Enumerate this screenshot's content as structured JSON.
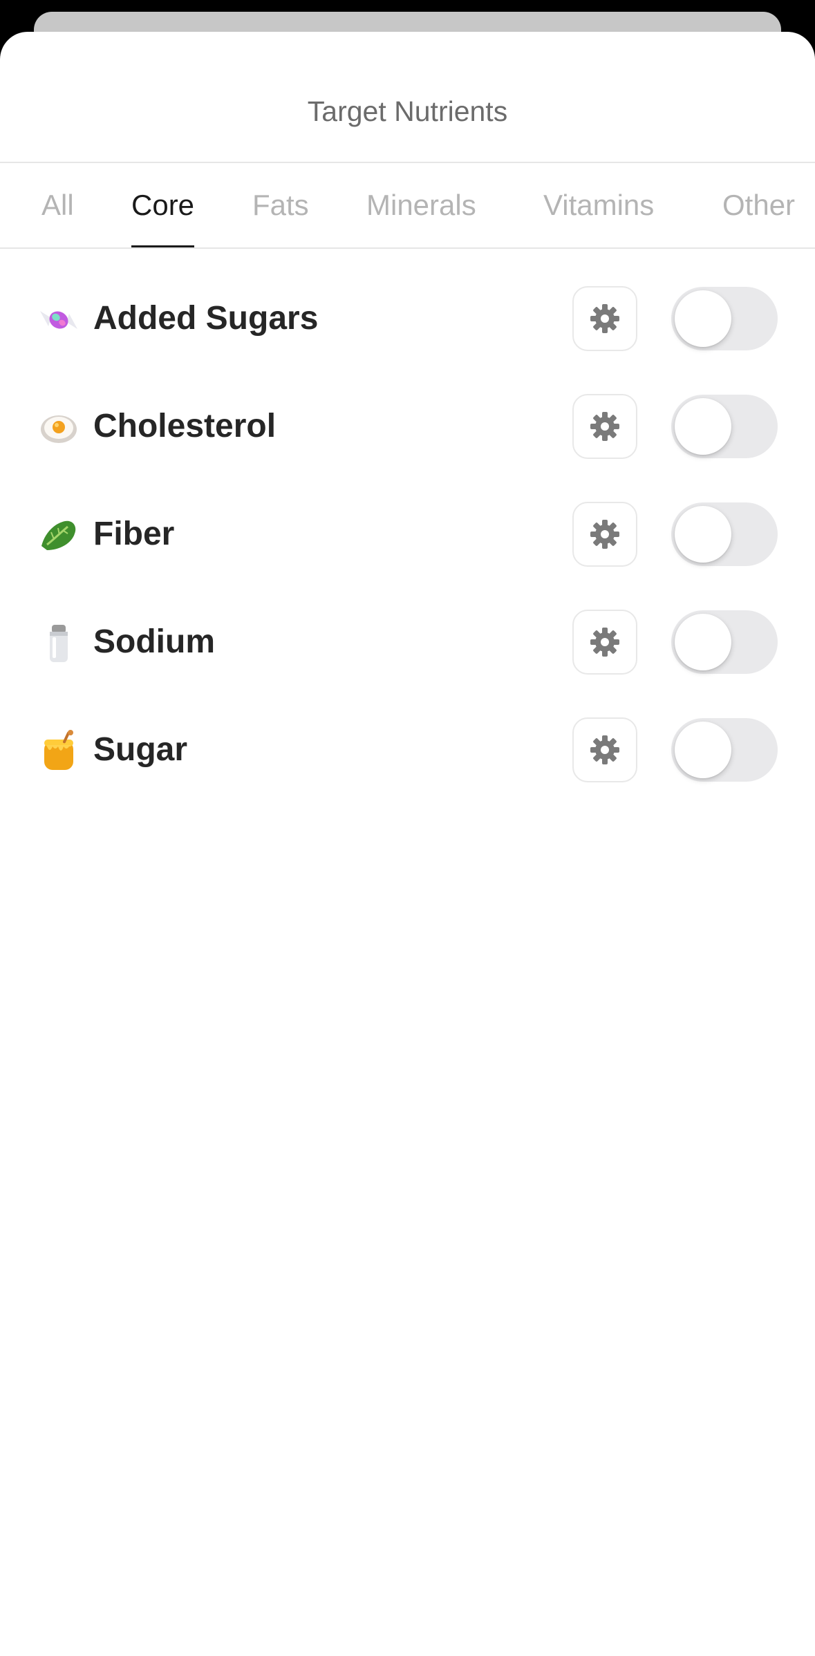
{
  "sheet": {
    "title": "Target Nutrients"
  },
  "tabs": [
    {
      "label": "All",
      "active": false
    },
    {
      "label": "Core",
      "active": true
    },
    {
      "label": "Fats",
      "active": false
    },
    {
      "label": "Minerals",
      "active": false
    },
    {
      "label": "Vitamins",
      "active": false
    },
    {
      "label": "Other",
      "active": false
    }
  ],
  "nutrients": [
    {
      "label": "Added Sugars",
      "icon": "candy-icon",
      "enabled": false
    },
    {
      "label": "Cholesterol",
      "icon": "fried-egg-icon",
      "enabled": false
    },
    {
      "label": "Fiber",
      "icon": "leafy-green-icon",
      "enabled": false
    },
    {
      "label": "Sodium",
      "icon": "salt-shaker-icon",
      "enabled": false
    },
    {
      "label": "Sugar",
      "icon": "honey-pot-icon",
      "enabled": false
    }
  ],
  "colors": {
    "active_tab": "#1a1a1a",
    "inactive_tab": "#b4b4b4",
    "toggle_off": "#e9e9eb",
    "gear": "#7a7a7a"
  }
}
